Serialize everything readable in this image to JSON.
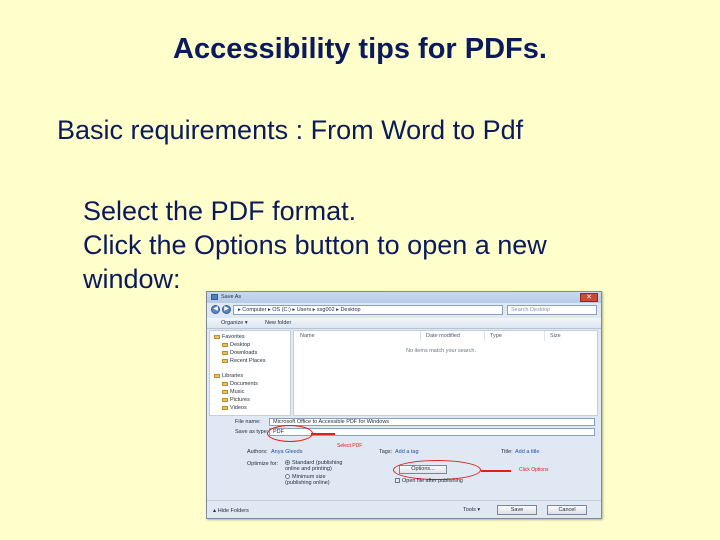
{
  "slide": {
    "title": "Accessibility tips for PDFs.",
    "subtitle": "Basic requirements : From Word to Pdf",
    "lines": [
      "Select the PDF format.",
      "Click the Options button to open a new",
      "window:"
    ]
  },
  "dialog": {
    "title": "Save As",
    "close": "✕",
    "back": "◀",
    "forward": "▶",
    "address": "▸ Computer ▸ OS (C:) ▸ Users ▸ sxg002 ▸ Desktop",
    "search_placeholder": "Search Desktop",
    "toolbar": {
      "organize": "Organize ▾",
      "new_folder": "New folder"
    },
    "nav": {
      "favorites": "Favorites",
      "desktop": "Desktop",
      "downloads": "Downloads",
      "recent": "Recent Places",
      "libraries": "Libraries",
      "documents": "Documents",
      "music": "Music",
      "pictures": "Pictures",
      "videos": "Videos"
    },
    "columns": {
      "name": "Name",
      "date_modified": "Date modified",
      "type": "Type",
      "size": "Size"
    },
    "empty_message": "No items match your search.",
    "file_name_label": "File name:",
    "file_name_value": "Microsoft Office to Accessible PDF for Windows",
    "save_as_type_label": "Save as type:",
    "save_as_type_value": "PDF",
    "select_pdf_annotation": "Select PDF",
    "authors_label": "Authors:",
    "authors_value": "Anya Gleeds",
    "tags_label": "Tags:",
    "tags_value": "Add a tag",
    "title_label": "Title:",
    "title_value": "Add a title",
    "optimize_label": "Optimize for:",
    "standard_option": "Standard (publishing online and printing)",
    "minimum_option": "Minimum size (publishing online)",
    "options_button": "Options...",
    "click_options_annotation": "Click Options",
    "open_after_publishing": "Open file after publishing",
    "hide_folders": "Hide Folders",
    "tools": "Tools ▾",
    "save": "Save",
    "cancel": "Cancel"
  },
  "colors": {
    "background": "#ffffcc",
    "text": "#0a1a5c",
    "annotation": "#e0201c"
  }
}
